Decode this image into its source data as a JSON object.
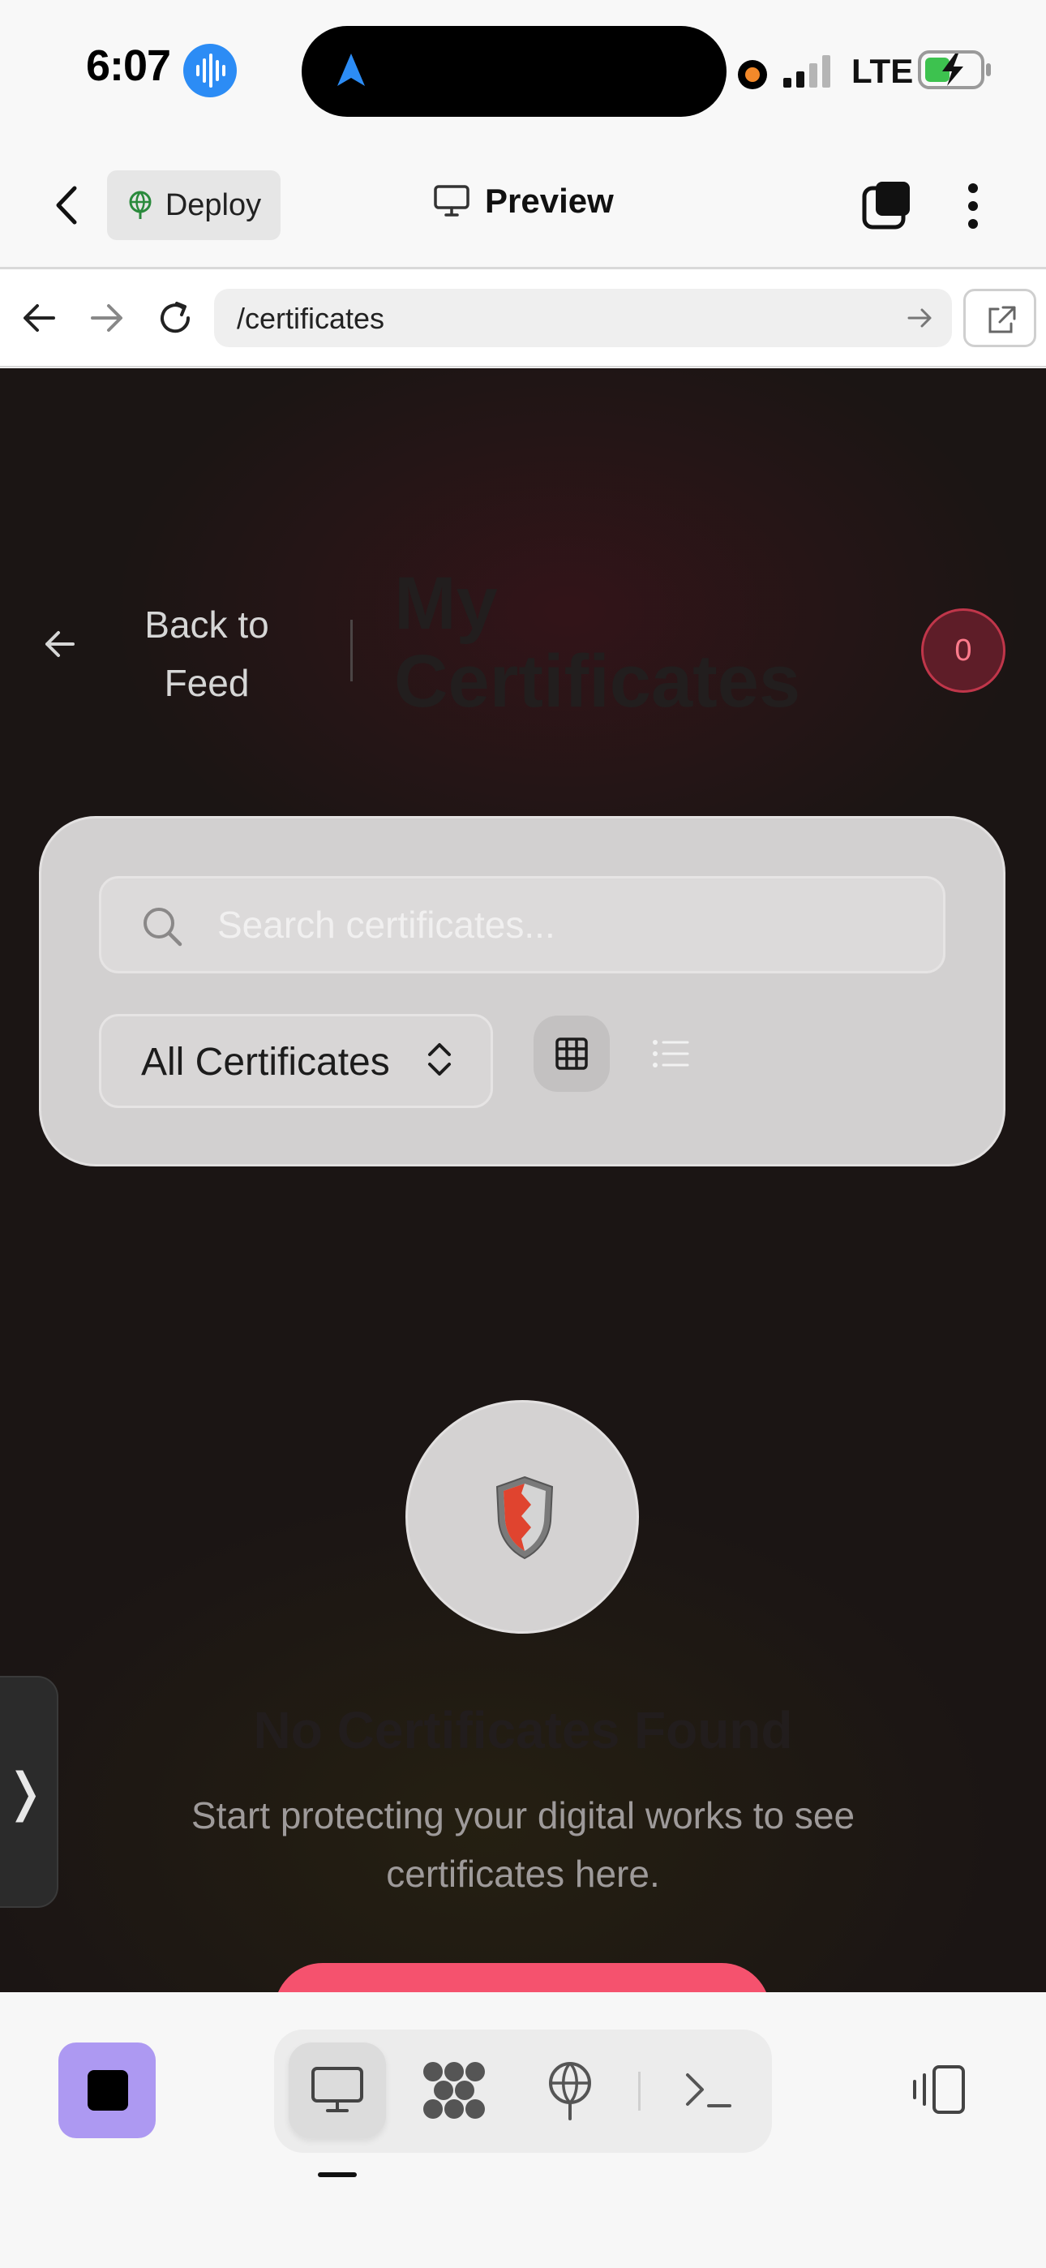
{
  "status_bar": {
    "time": "6:07",
    "network": "LTE",
    "icons": [
      "siri-waveform-icon",
      "location-arrow-icon",
      "recording-dot-icon",
      "signal-bars-icon",
      "battery-charging-icon"
    ]
  },
  "app_header": {
    "deploy_label": "Deploy",
    "title": "Preview",
    "icons": [
      "back-chevron-icon",
      "globe-icon",
      "monitor-icon",
      "tabs-icon",
      "more-vertical-icon"
    ]
  },
  "url_bar": {
    "url": "/certificates",
    "icons": [
      "back-arrow-icon",
      "forward-arrow-icon",
      "reload-icon",
      "go-arrow-icon",
      "open-external-icon"
    ]
  },
  "page": {
    "back_label": "Back to Feed",
    "title": "My Certificates",
    "count": "0",
    "search_placeholder": "Search certificates...",
    "filter_selected": "All Certificates",
    "view_modes": [
      "grid",
      "list"
    ],
    "active_view": "grid",
    "empty_title": "No Certificates Found",
    "empty_description": "Start protecting your digital works to see certificates here.",
    "side_tab_glyph": "❭",
    "colors": {
      "accent": "#f5526e",
      "background": "#1b1514",
      "badge": "#5e1d28"
    }
  },
  "toolbar": {
    "items": [
      "stop",
      "desktop",
      "integrations",
      "deploy",
      "terminal",
      "device-toggle"
    ],
    "active": "desktop",
    "colors": {
      "stop": "#ad99f2"
    }
  }
}
